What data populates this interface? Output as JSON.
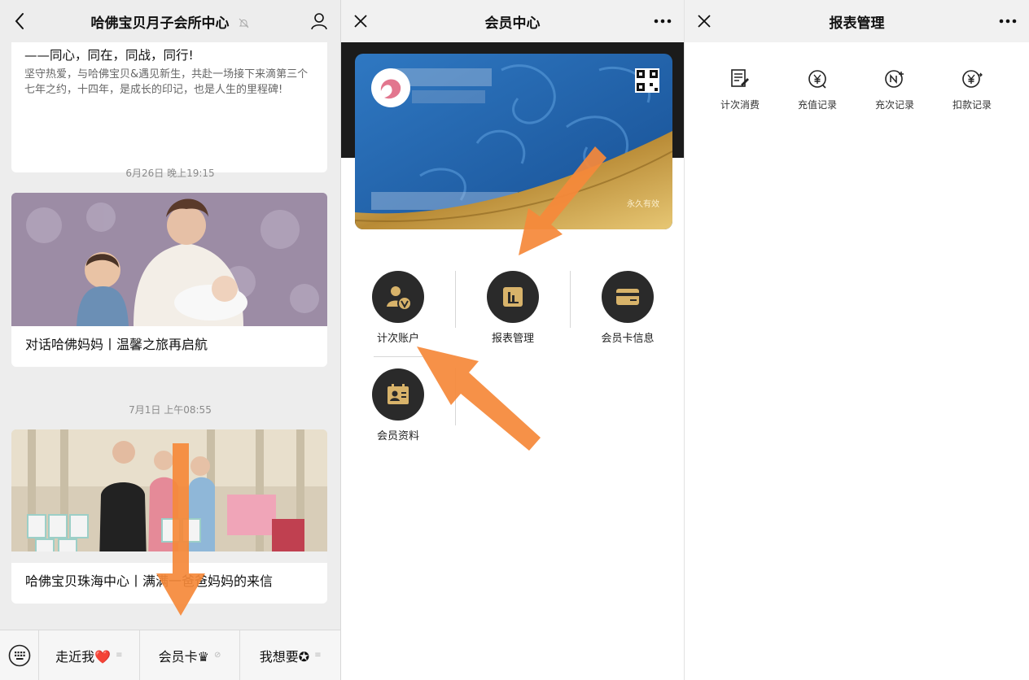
{
  "panel_chat": {
    "title": "哈佛宝贝月子会所中心",
    "card1": {
      "headline_cut": "...",
      "headline": "——同心，同在，同战，同行!",
      "body": "坚守热爱，与哈佛宝贝&遇见新生，共赴一场接下来滴第三个七年之约，十四年，是成长的印记，也是人生的里程碑!"
    },
    "time1": "6月26日 晚上19:15",
    "article1_title": "对话哈佛妈妈丨温馨之旅再启航",
    "time2": "7月1日 上午08:55",
    "article2_title": "哈佛宝贝珠海中心丨满满一爸爸妈妈的来信",
    "menu": [
      {
        "label": "走近我❤️",
        "mark": "≡"
      },
      {
        "label": "会员卡♛",
        "mark": "⊘"
      },
      {
        "label": "我想要✪",
        "mark": "≡"
      }
    ]
  },
  "panel_member": {
    "title": "会员中心",
    "card_badge": "永久有效",
    "items": [
      {
        "label": "计次账户",
        "icon": "user-v-icon"
      },
      {
        "label": "报表管理",
        "icon": "report-icon"
      },
      {
        "label": "会员卡信息",
        "icon": "card-icon"
      },
      {
        "label": "会员资料",
        "icon": "profile-icon"
      }
    ]
  },
  "panel_report": {
    "title": "报表管理",
    "items": [
      {
        "label": "计次消费",
        "icon": "document-pen-icon"
      },
      {
        "label": "充值记录",
        "icon": "yuan-circle-icon"
      },
      {
        "label": "充次记录",
        "icon": "n-plus-circle-icon"
      },
      {
        "label": "扣款记录",
        "icon": "yuan-swap-icon"
      }
    ]
  },
  "colors": {
    "arrow": "#f5893a",
    "dark": "#2a2a2a",
    "gold": "#d8b36a",
    "card_blue": "#1f5fa6"
  }
}
